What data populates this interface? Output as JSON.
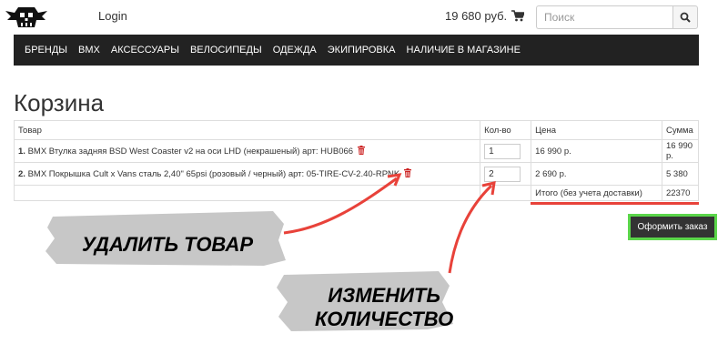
{
  "header": {
    "login_label": "Login",
    "cart_total": "19 680 руб.",
    "search_placeholder": "Поиск"
  },
  "nav": [
    "БРЕНДЫ",
    "BMX",
    "АКСЕССУАРЫ",
    "ВЕЛОСИПЕДЫ",
    "ОДЕЖДА",
    "ЭКИПИРОВКА",
    "НАЛИЧИЕ В МАГАЗИНЕ"
  ],
  "page_title": "Корзина",
  "table": {
    "headers": {
      "product": "Товар",
      "qty": "Кол-во",
      "price": "Цена",
      "sum": "Сумма"
    },
    "rows": [
      {
        "num": "1.",
        "name": "BMX Втулка задняя BSD West Coaster v2 на оси LHD (некрашеный) арт: HUB066",
        "qty": "1",
        "price": "16 990 р.",
        "sum": "16 990 р."
      },
      {
        "num": "2.",
        "name": "BMX Покрышка Cult x Vans сталь 2,40\" 65psi (розовый / черный) арт: 05-TIRE-CV-2.40-RPNK",
        "qty": "2",
        "price": "2 690 р.",
        "sum": "5 380"
      }
    ],
    "total_label": "Итого (без учета доставки)",
    "total_value": "22370"
  },
  "order_button": "Оформить заказ",
  "annotations": {
    "delete_item": "УДАЛИТЬ ТОВАР",
    "change_qty_line1": "ИЗМЕНИТЬ",
    "change_qty_line2": "КОЛИЧЕСТВО"
  },
  "colors": {
    "nav_bg": "#222222",
    "annotation_arrow": "#e8423a",
    "order_button_border": "#5bd64a",
    "trash_icon": "#cc2222"
  }
}
